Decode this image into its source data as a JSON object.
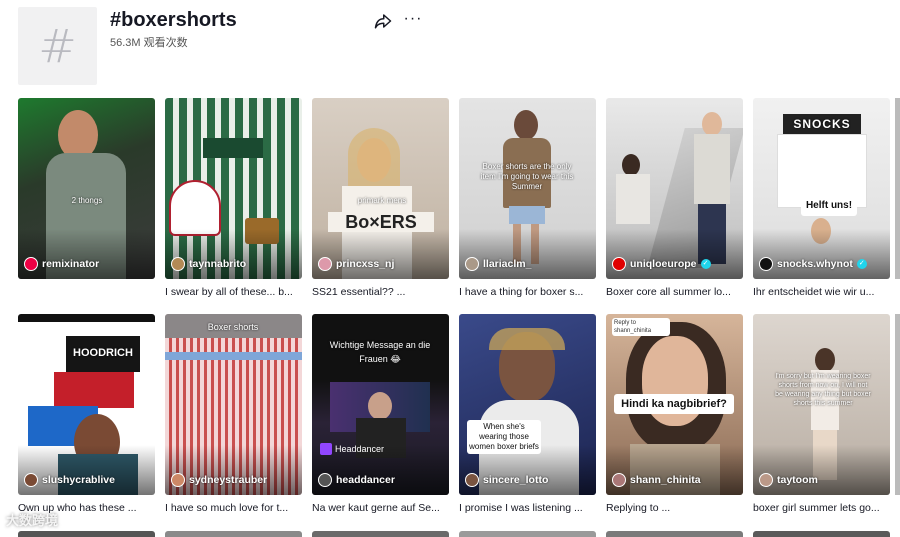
{
  "header": {
    "avatar_glyph": "#",
    "title": "#boxershorts",
    "views": "56.3M 观看次数",
    "share_icon": "share-icon",
    "more_label": "···"
  },
  "videos": [
    {
      "author": "remixinator",
      "caption": "",
      "overlay": "2 thongs",
      "verified": false
    },
    {
      "author": "taynnabrito",
      "caption": "I swear by all of these... b...",
      "overlay": "",
      "verified": false
    },
    {
      "author": "princxss_nj",
      "caption": "SS21 essential?? ...",
      "overlay": "primark mens",
      "sticker": "Bo×ERS",
      "verified": false
    },
    {
      "author": "llariaclm_",
      "caption": "I have a thing for boxer s...",
      "overlay": "Boxer shorts are the only item I'm going to wear this Summer",
      "verified": false
    },
    {
      "author": "uniqloeurope",
      "caption": "Boxer core all summer lo...",
      "overlay": "",
      "verified": true
    },
    {
      "author": "snocks.whynot",
      "caption": "Ihr entscheidet wie wir u...",
      "overlay": "SNOCKS",
      "sticker": "Helft uns!",
      "verified": true
    },
    {
      "author": "slushycrablive",
      "caption": "Own up who has these ...",
      "overlay": "HOODRICH",
      "verified": false
    },
    {
      "author": "sydneystrauber",
      "caption": "I have so much love for t...",
      "overlay": "Boxer shorts",
      "verified": false
    },
    {
      "author": "headdancer",
      "caption": "Na wer kaut gerne auf Se...",
      "overlay": "Wichtige Message an die Frauen 😂",
      "tag": "Headdancer",
      "verified": false
    },
    {
      "author": "sincere_lotto",
      "caption": "I promise I was listening ...",
      "overlay": "When she's wearing those women boxer briefs",
      "verified": false
    },
    {
      "author": "shann_chinita",
      "caption": "Replying to ...",
      "overlay": "Reply to shann_chinita",
      "sticker": "Hindi ka nagbibrief?",
      "verified": false
    },
    {
      "author": "taytoom",
      "caption": "boxer girl summer lets go...",
      "overlay": "I'm sorry but I'm wearing boxer shorts from now on, I will not be wearing any thing but boxer shorts this summer",
      "verified": false
    }
  ],
  "watermark": "大数跨境",
  "colors": {
    "verified": "#20d5ec",
    "text": "#161823"
  }
}
